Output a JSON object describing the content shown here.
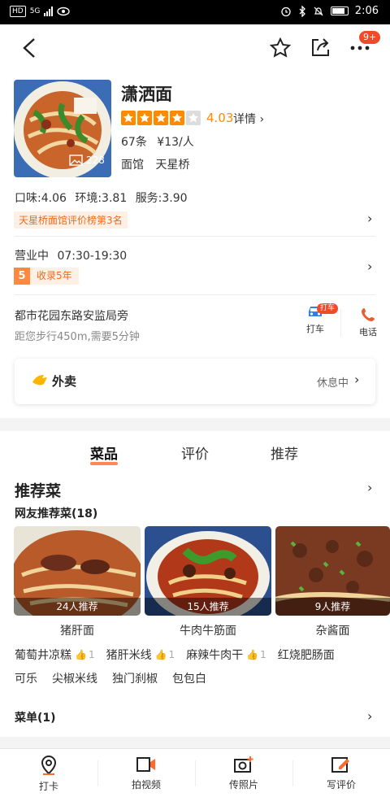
{
  "status_bar": {
    "network": "HD",
    "network2": "5G",
    "time": "2:06"
  },
  "nav": {
    "notification_count": "9+"
  },
  "shop": {
    "name": "潇洒面",
    "score": "4.03",
    "detail_label": "详情",
    "rating_stars": 4,
    "reviews": "67条",
    "price": "¥13/人",
    "category": "面馆",
    "area": "天星桥",
    "photo_count": "228"
  },
  "scores": {
    "taste": "口味:4.06",
    "environment": "环境:3.81",
    "service": "服务:3.90"
  },
  "rank_label": "天星桥面馆评价榜第3名",
  "hours": {
    "status": "营业中",
    "time": "07:30-19:30"
  },
  "collect": {
    "years_num": "5",
    "label": "收录5年"
  },
  "location": {
    "address": "都市花园东路安监局旁",
    "distance": "距您步行450m,需要5分钟",
    "taxi_label": "打车",
    "taxi_badge": "打车",
    "call_label": "电话"
  },
  "takeout": {
    "label": "外卖",
    "status": "休息中"
  },
  "tabs": [
    "菜品",
    "评价",
    "推荐"
  ],
  "dishes_section": {
    "title": "推荐菜",
    "subtitle": "网友推荐菜(18)",
    "dishes": [
      {
        "name": "猪肝面",
        "recommend": "24人推荐"
      },
      {
        "name": "牛肉牛筋面",
        "recommend": "15人推荐"
      },
      {
        "name": "杂酱面",
        "recommend": "9人推荐"
      }
    ],
    "chips_row1": [
      {
        "name": "葡萄井凉糕",
        "likes": "1"
      },
      {
        "name": "猪肝米线",
        "likes": "1"
      },
      {
        "name": "麻辣牛肉干",
        "likes": "1"
      },
      {
        "name": "红烧肥肠面",
        "likes": ""
      }
    ],
    "chips_row2": [
      "可乐",
      "尖椒米线",
      "独门刹椒",
      "包包白"
    ]
  },
  "menu_row": "菜单(1)",
  "bottom_bar": [
    "打卡",
    "拍视频",
    "传照片",
    "写评价"
  ],
  "colors": {
    "accent": "#ff8a00",
    "tag_bg": "#fff0e6",
    "tag_text": "#f06a1e",
    "badge": "#f04a2a"
  }
}
